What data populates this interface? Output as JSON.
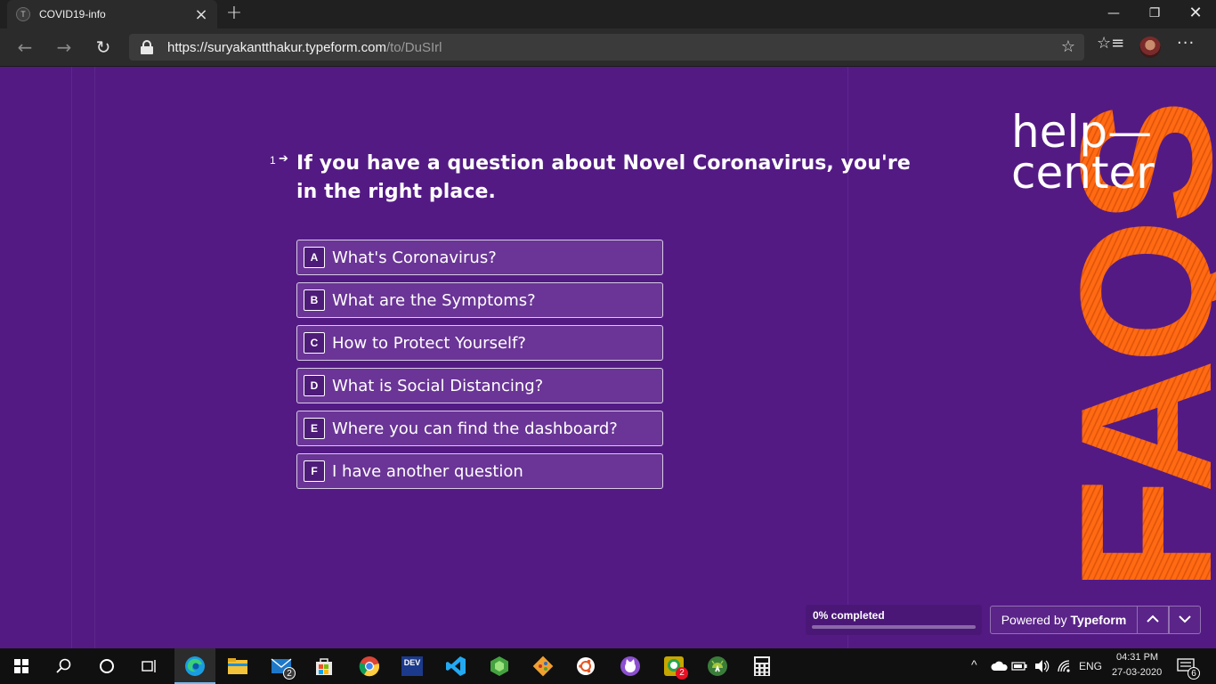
{
  "browser": {
    "tab_title": "COVID19-info",
    "tab_favicon_letter": "T",
    "url_host": "https://suryakantthakur.typeform.com",
    "url_path": "/to/DuSIrl"
  },
  "form": {
    "question_number": "1",
    "question_text": "If you have a question about Novel Coronavirus, you're in the right place.",
    "choices": [
      {
        "key": "A",
        "label": "What's Coronavirus?"
      },
      {
        "key": "B",
        "label": "What are the Symptoms?"
      },
      {
        "key": "C",
        "label": "How to Protect Yourself?"
      },
      {
        "key": "D",
        "label": "What is Social Distancing?"
      },
      {
        "key": "E",
        "label": "Where you can find the dashboard?"
      },
      {
        "key": "F",
        "label": "I have another question"
      }
    ],
    "progress_label": "0% completed",
    "progress_fraction": 0,
    "powered_prefix": "Powered by",
    "powered_brand": "Typeform"
  },
  "brand_art": {
    "help_line1": "help—",
    "help_line2": "center",
    "faqs_text": "FAQS",
    "accent_color": "#ff6a13",
    "background_color": "#531a84"
  },
  "taskbar": {
    "mail_badge": "2",
    "whatsapp_badge": "2",
    "devto_label": "DEV",
    "language": "ENG",
    "time": "04:31 PM",
    "date": "27-03-2020",
    "notifications": "6"
  }
}
